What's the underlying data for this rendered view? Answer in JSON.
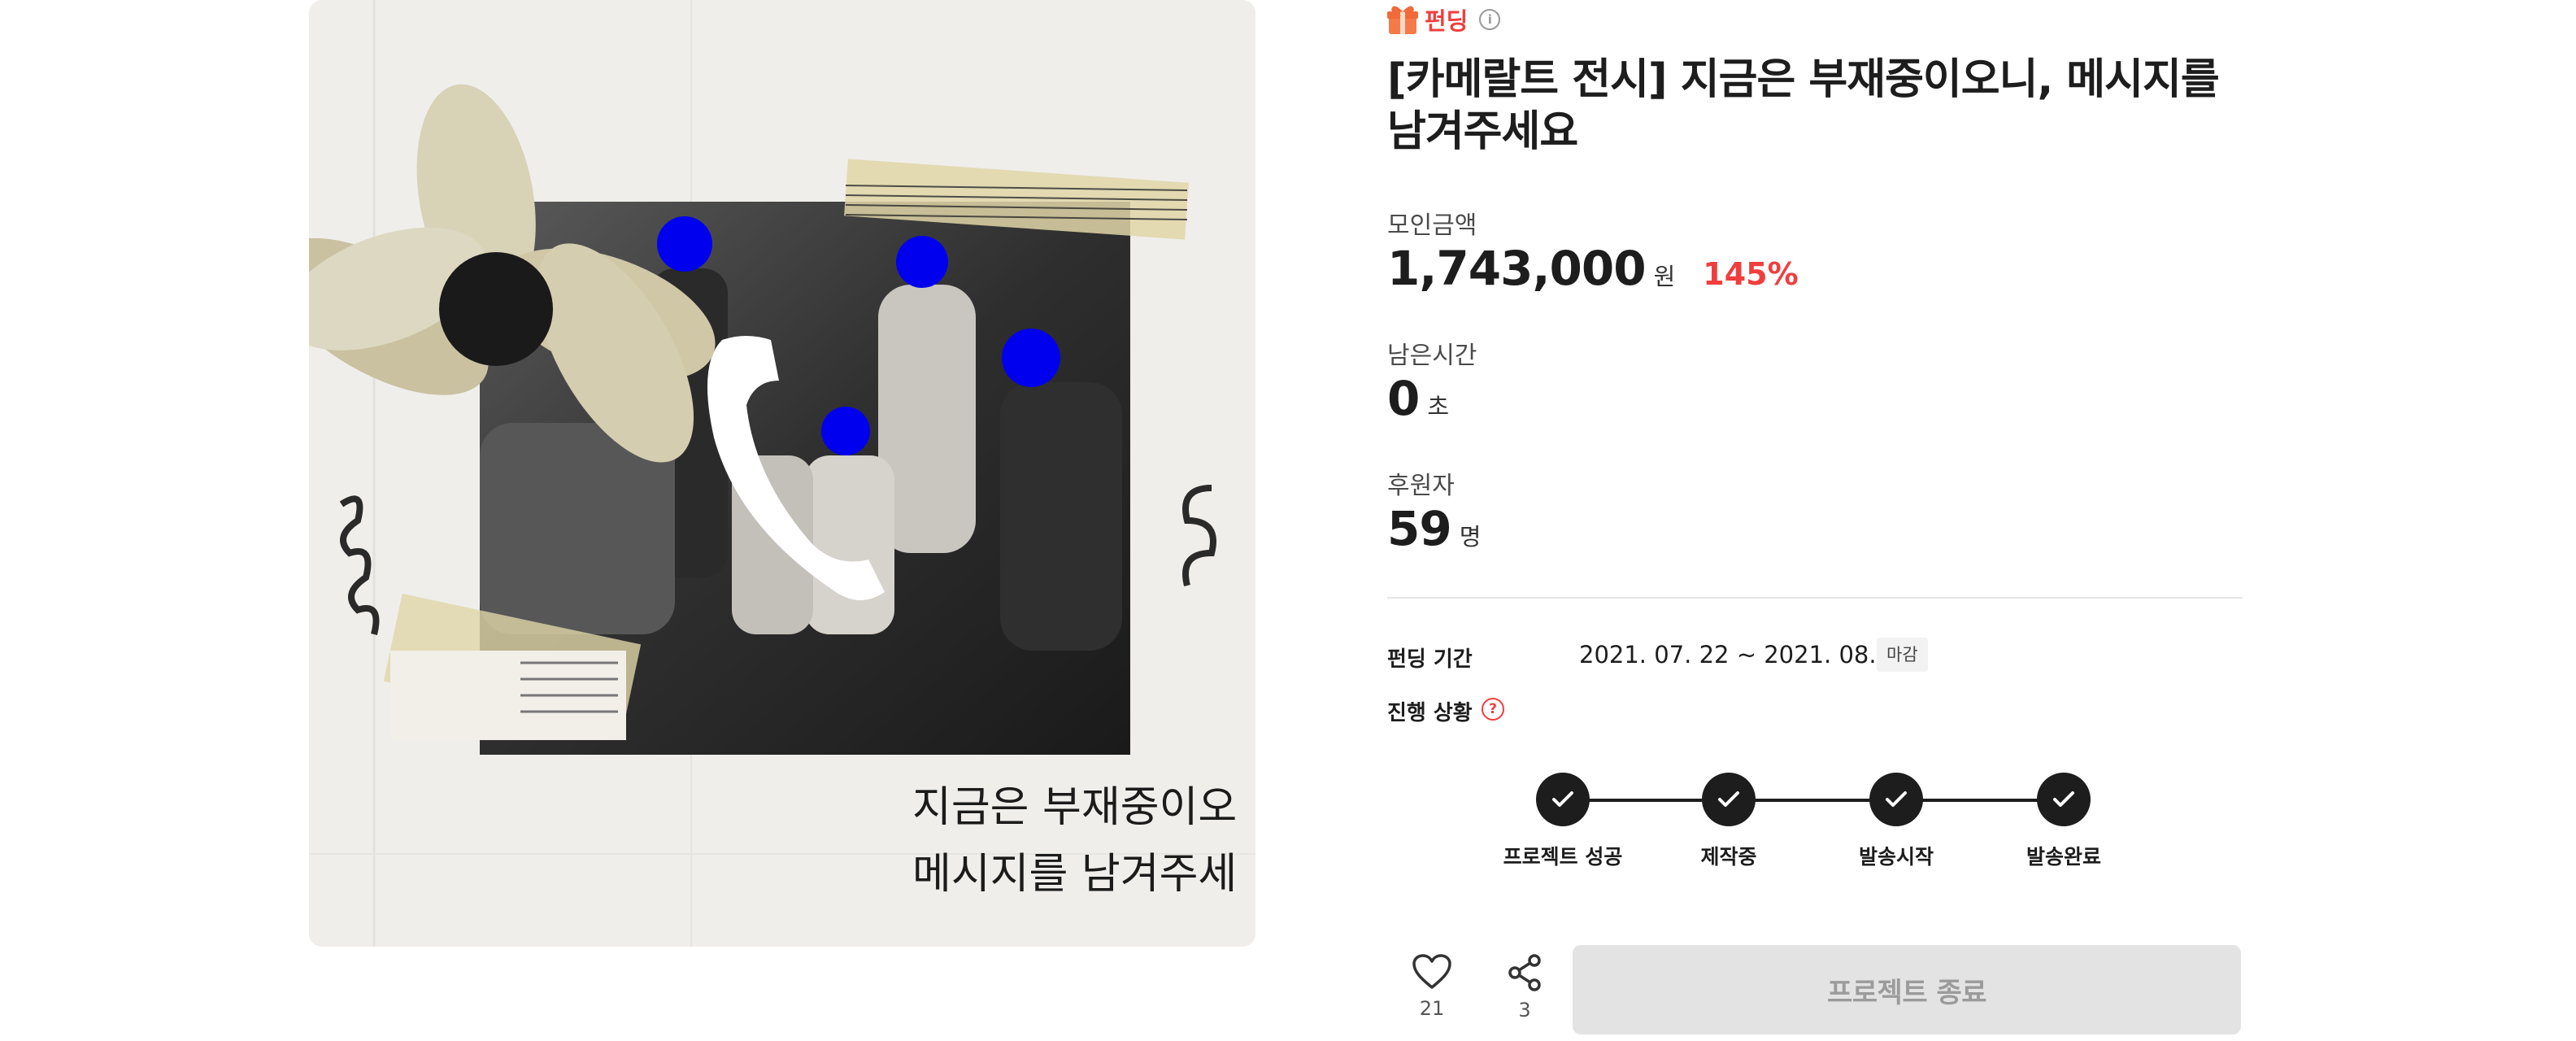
{
  "hero": {
    "caption_line1": "지금은 부재중이오",
    "caption_line2": "메시지를 남겨주세"
  },
  "project": {
    "category": "펀딩",
    "title": "[카메랄트 전시] 지금은 부재중이오니, 메시지를 남겨주세요"
  },
  "stats": {
    "amount_label": "모인금액",
    "amount_value": "1,743,000",
    "amount_unit": "원",
    "amount_percent": "145%",
    "time_label": "남은시간",
    "time_value": "0",
    "time_unit": "초",
    "backers_label": "후원자",
    "backers_value": "59",
    "backers_unit": "명"
  },
  "details": {
    "period_label": "펀딩 기간",
    "period_value": "2021. 07. 22 ~ 2021. 08. 04",
    "period_badge": "마감",
    "status_label": "진행 상황"
  },
  "progress": {
    "steps": [
      {
        "label": "프로젝트 성공",
        "done": true
      },
      {
        "label": "제작중",
        "done": true
      },
      {
        "label": "발송시작",
        "done": true
      },
      {
        "label": "발송완료",
        "done": true
      }
    ]
  },
  "actions": {
    "like_count": "21",
    "share_count": "3",
    "end_button": "프로젝트 종료"
  },
  "colors": {
    "accent": "#f03e3e",
    "text": "#1d1d1d",
    "disabled_bg": "#e3e3e3",
    "disabled_text": "#9b9b9b"
  }
}
